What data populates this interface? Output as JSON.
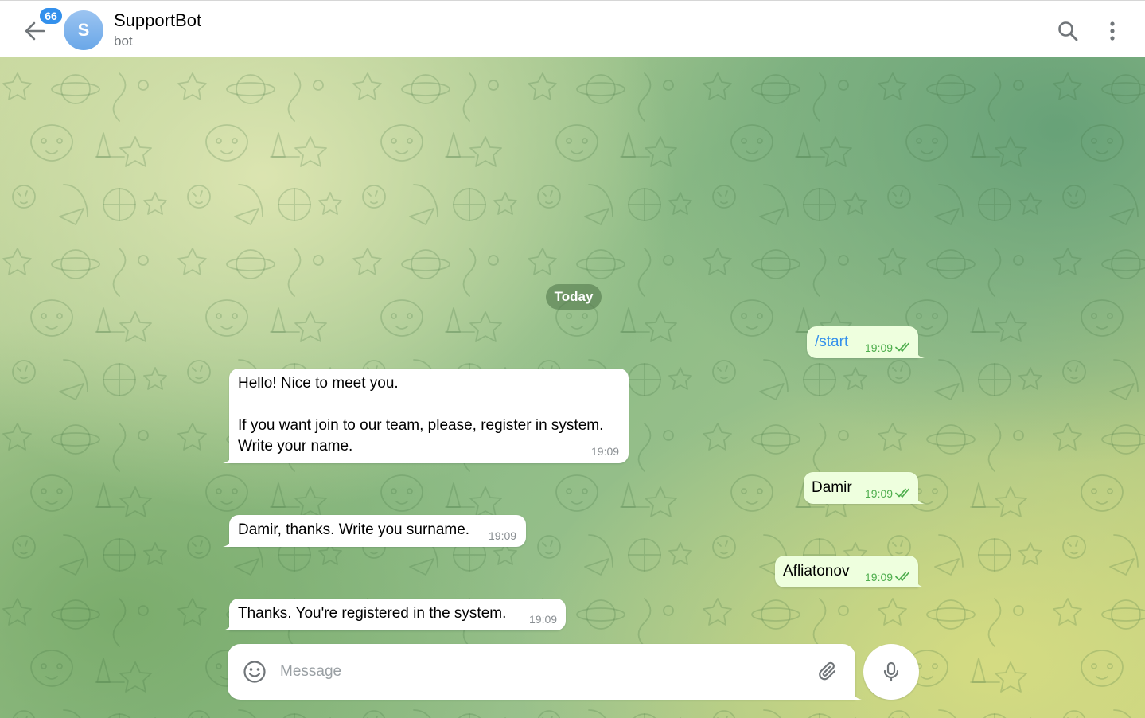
{
  "header": {
    "unread_count": "66",
    "avatar_letter": "S",
    "title": "SupportBot",
    "subtitle": "bot",
    "icons": {
      "back": "arrow-left-icon",
      "search": "search-icon",
      "more": "more-vertical-icon"
    }
  },
  "chat": {
    "date_label": "Today",
    "messages": [
      {
        "direction": "out",
        "text": "/start",
        "time": "19:09",
        "status": "read"
      },
      {
        "direction": "in",
        "lines": [
          "Hello! Nice to meet you.",
          "",
          "If you want join to our team, please, register in system.",
          "Write your name."
        ],
        "time": "19:09"
      },
      {
        "direction": "out",
        "text": "Damir",
        "time": "19:09",
        "status": "read"
      },
      {
        "direction": "in",
        "text": "Damir, thanks. Write you surname.",
        "time": "19:09"
      },
      {
        "direction": "out",
        "text": "Afliatonov",
        "time": "19:09",
        "status": "read"
      },
      {
        "direction": "in",
        "text": "Thanks. You're registered in the system.",
        "time": "19:09"
      }
    ]
  },
  "composer": {
    "placeholder": "Message",
    "value": "",
    "icons": {
      "emoji": "smile-icon",
      "attach": "paperclip-icon",
      "mic": "microphone-icon"
    }
  },
  "colors": {
    "accent": "#3390ec",
    "outgoing_bubble": "#eeffde",
    "incoming_bubble": "#ffffff",
    "read_ticks": "#4fae4e"
  }
}
